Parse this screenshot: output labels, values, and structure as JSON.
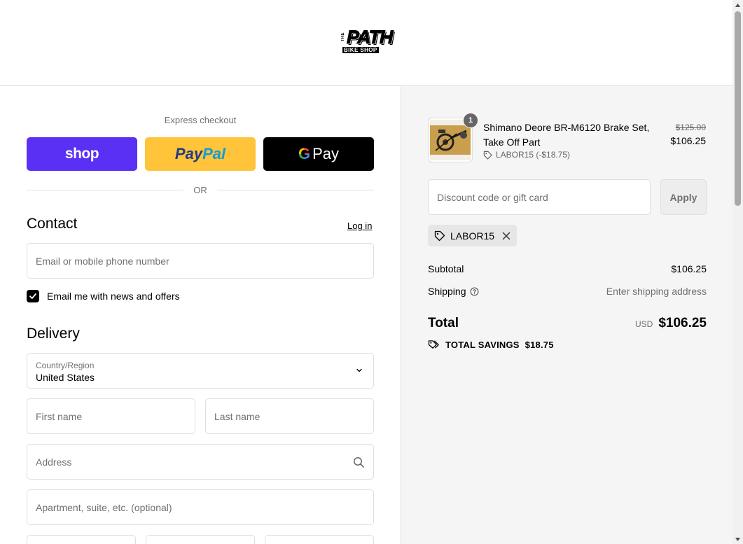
{
  "header": {
    "logo_top": "THE",
    "logo_main": "PATH",
    "logo_sub": "BIKE SHOP"
  },
  "express": {
    "title": "Express checkout",
    "shop_label": "shop",
    "paypal_pay": "Pay",
    "paypal_pal": "Pal",
    "gpay_g": "G",
    "gpay_label": "Pay",
    "or_label": "OR"
  },
  "contact": {
    "title": "Contact",
    "login_label": "Log in",
    "email_placeholder": "Email or mobile phone number",
    "news_checkbox_label": "Email me with news and offers",
    "news_checked": true
  },
  "delivery": {
    "title": "Delivery",
    "country_label": "Country/Region",
    "country_value": "United States",
    "first_name_placeholder": "First name",
    "last_name_placeholder": "Last name",
    "address_placeholder": "Address",
    "apartment_placeholder": "Apartment, suite, etc. (optional)"
  },
  "order": {
    "item": {
      "quantity": "1",
      "name": "Shimano Deore BR-M6120 Brake Set, Take Off Part",
      "discount": "LABOR15 (-$18.75)",
      "original_price": "$125.00",
      "price": "$106.25"
    },
    "discount_placeholder": "Discount code or gift card",
    "apply_label": "Apply",
    "applied_code": "LABOR15",
    "subtotal_label": "Subtotal",
    "subtotal_value": "$106.25",
    "shipping_label": "Shipping",
    "shipping_value": "Enter shipping address",
    "total_label": "Total",
    "currency": "USD",
    "total_value": "$106.25",
    "savings_label": "TOTAL SAVINGS",
    "savings_value": "$18.75"
  },
  "colors": {
    "shop": "#5a31f4",
    "paypal": "#ffc439",
    "gpay": "#000000",
    "summary_bg": "#f5f5f5"
  },
  "icons": [
    "chevron-down-icon",
    "search-icon",
    "tag-icon",
    "close-icon",
    "help-icon",
    "savings-tag-icon",
    "checkmark-icon"
  ]
}
